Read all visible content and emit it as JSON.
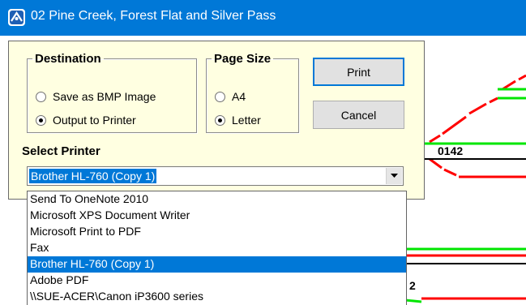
{
  "window": {
    "title": "02 Pine Creek, Forest Flat and Silver Pass",
    "app_icon": "app-logo-icon"
  },
  "canvas": {
    "labels": [
      "0142",
      "2"
    ],
    "colors": {
      "red": "#ff0000",
      "green": "#00e600",
      "black": "#000000"
    }
  },
  "dialog": {
    "destination": {
      "legend": "Destination",
      "options": [
        {
          "label": "Save as BMP Image",
          "checked": false
        },
        {
          "label": "Output to Printer",
          "checked": true
        }
      ]
    },
    "page_size": {
      "legend": "Page Size",
      "options": [
        {
          "label": "A4",
          "checked": false
        },
        {
          "label": "Letter",
          "checked": true
        }
      ]
    },
    "print_label": "Print",
    "cancel_label": "Cancel",
    "select_printer_label": "Select Printer",
    "printer_combo": {
      "value": "Brother HL-760 (Copy 1)",
      "icon": "chevron-down-icon"
    },
    "printer_list": [
      "Send To OneNote 2010",
      "Microsoft XPS Document Writer",
      "Microsoft Print to PDF",
      "Fax",
      "Brother HL-760 (Copy 1)",
      "Adobe PDF",
      "\\\\SUE-ACER\\Canon iP3600 series"
    ],
    "printer_list_selected": "Brother HL-760 (Copy 1)"
  },
  "colors": {
    "titlebar": "#0078d7",
    "dialog_bg": "#ffffe1",
    "selection": "#0078d7"
  }
}
